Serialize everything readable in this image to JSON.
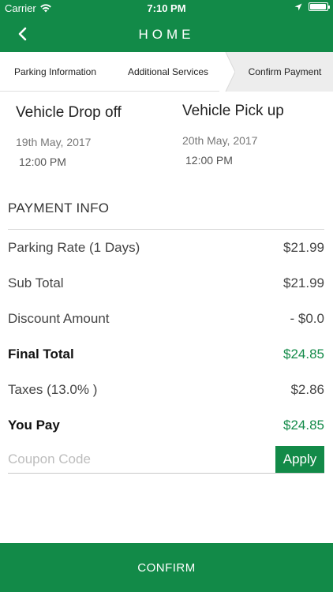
{
  "status_bar": {
    "carrier": "Carrier",
    "time": "7:10 PM"
  },
  "nav": {
    "title": "HOME",
    "back_icon": "chevron-left-icon"
  },
  "steps": [
    {
      "label": "Parking Information",
      "active": false
    },
    {
      "label": "Additional Services",
      "active": false
    },
    {
      "label": "Confirm Payment",
      "active": true
    }
  ],
  "drop_off": {
    "title": "Vehicle Drop off",
    "date": "19th May, 2017",
    "time": "12:00 PM"
  },
  "pick_up": {
    "title": "Vehicle Pick up",
    "date": "20th May, 2017",
    "time": "12:00 PM"
  },
  "payment_info": {
    "title": "PAYMENT INFO",
    "rows": [
      {
        "label": "Parking Rate (1 Days)",
        "value": "$21.99",
        "emphasis": false
      },
      {
        "label": "Sub Total",
        "value": "$21.99",
        "emphasis": false
      },
      {
        "label": "Discount Amount",
        "value": "- $0.0",
        "emphasis": false
      },
      {
        "label": "Final Total",
        "value": "$24.85",
        "emphasis": true
      },
      {
        "label": "Taxes (13.0% )",
        "value": "$2.86",
        "emphasis": false
      },
      {
        "label": "You Pay",
        "value": "$24.85",
        "emphasis": true
      }
    ]
  },
  "coupon": {
    "placeholder": "Coupon Code",
    "value": "",
    "apply_label": "Apply"
  },
  "confirm_label": "CONFIRM",
  "colors": {
    "brand_green": "#128a48",
    "active_step_bg": "#ededed"
  }
}
